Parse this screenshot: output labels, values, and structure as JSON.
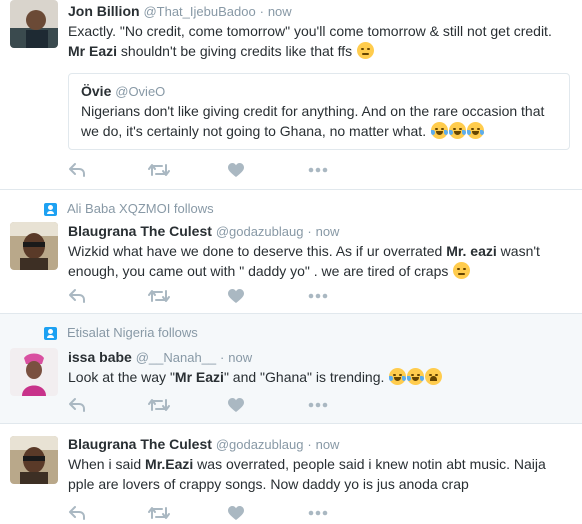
{
  "colors": {
    "accent": "#1da1f2",
    "muted": "#8899a6",
    "text": "#292f33",
    "border": "#e1e8ed"
  },
  "tweets": [
    {
      "name": "Jon Billion",
      "handle": "@That_IjebuBadoo",
      "sep": "·",
      "time": "now",
      "text_1": "Exactly. \"No credit, come tomorrow\" you'll come tomorrow & still not get credit.",
      "text_bold": "Mr Eazi",
      "text_2": " shouldn't be giving credits like that ffs",
      "emoji": "unamused-face-icon",
      "quote": {
        "name": "Övie",
        "handle": "@OvieO",
        "text": "Nigerians don't like giving credit for anything. And on the rare occasion that we do, it's certainly not going to Ghana, no matter what."
      }
    },
    {
      "context": "Ali Baba XQZMOI follows",
      "name": "Blaugrana The Culest",
      "handle": "@godazublaug",
      "sep": "·",
      "time": "now",
      "text_1": "Wizkid what have we done to deserve this. As if ur overrated ",
      "text_bold": "Mr. eazi",
      "text_2": " wasn't enough, you came out with \" daddy yo\" . we are tired of craps"
    },
    {
      "context": "Etisalat Nigeria follows",
      "name": "issa babe",
      "handle": "@__Nanah__",
      "sep": "·",
      "time": "now",
      "text_1": "Look at the way \"",
      "text_bold": "Mr Eazi",
      "text_2": "\" and \"Ghana\" is trending."
    },
    {
      "name": "Blaugrana The Culest",
      "handle": "@godazublaug",
      "sep": "·",
      "time": "now",
      "text_1": "When i said ",
      "text_bold": "Mr.Eazi",
      "text_2": " was overrated, people said i knew notin abt music. Naija pple are lovers of crappy songs. Now daddy yo is jus anoda crap"
    }
  ]
}
